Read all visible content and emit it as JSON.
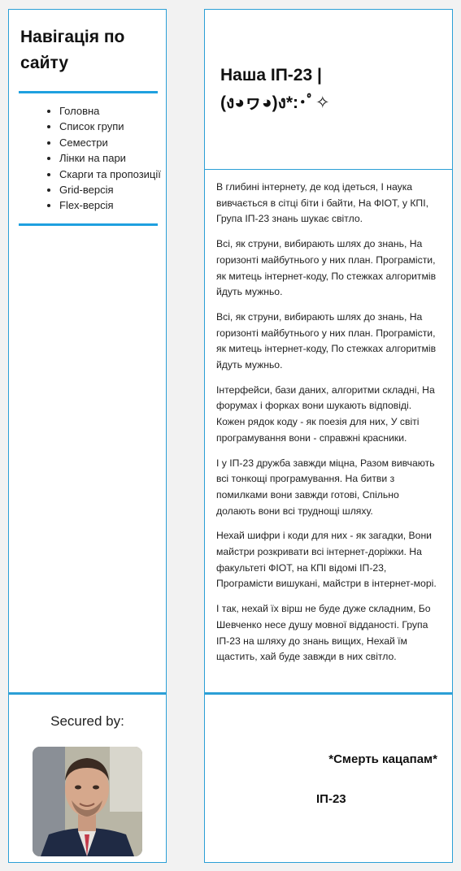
{
  "nav": {
    "title": "Навігація по сайту",
    "items": [
      "Головна",
      "Список групи",
      "Семестри",
      "Лінки на пари",
      "Скарги та пропозиції",
      "Grid-версія",
      "Flex-версія"
    ]
  },
  "header": {
    "title": "Наша ІП-23 |\n(ง◕ヮ◕)ง*:･ﾟ✧"
  },
  "main": {
    "paragraphs": [
      "В глибині інтернету, де код ідеться, І наука вивчається в сітці біти і байти, На ФІОТ, у КПІ, Група ІП-23 знань шукає світло.",
      "Всі, як струни, вибирають шлях до знань, На горизонті майбутнього у них план. Програмісти, як митець інтернет-коду, По стежках алгоритмів йдуть мужньо.",
      "Всі, як струни, вибирають шлях до знань, На горизонті майбутнього у них план. Програмісти, як митець інтернет-коду, По стежках алгоритмів йдуть мужньо.",
      "Інтерфейси, бази даних, алгоритми складні, На форумах і форках вони шукають відповіді. Кожен рядок коду - як поезія для них, У світі програмування вони - справжні красники.",
      "І у ІП-23 дружба завжди міцна, Разом вивчають всі тонкощі програмування. На битви з помилками вони завжди готові, Спільно долають вони всі труднощі шляху.",
      "Нехай шифри і коди для них - як загадки, Вони майстри розкривати всі інтернет-доріжки. На факультеті ФІОТ, на КПІ відомі ІП-23, Програмісти вишукані, майстри в інтернет-морі.",
      "І так, нехай їх вірш не буде дуже складним, Бо Шевченко несе душу мовної відданості. Група ІП-23 на шляху до знань вищих, Нехай їм щастить, хай буде завжди в них світло."
    ]
  },
  "sidefooter": {
    "secured_label": "Secured by:"
  },
  "footer": {
    "motto": "*Смерть кацапам*",
    "group": "ІП-23"
  }
}
